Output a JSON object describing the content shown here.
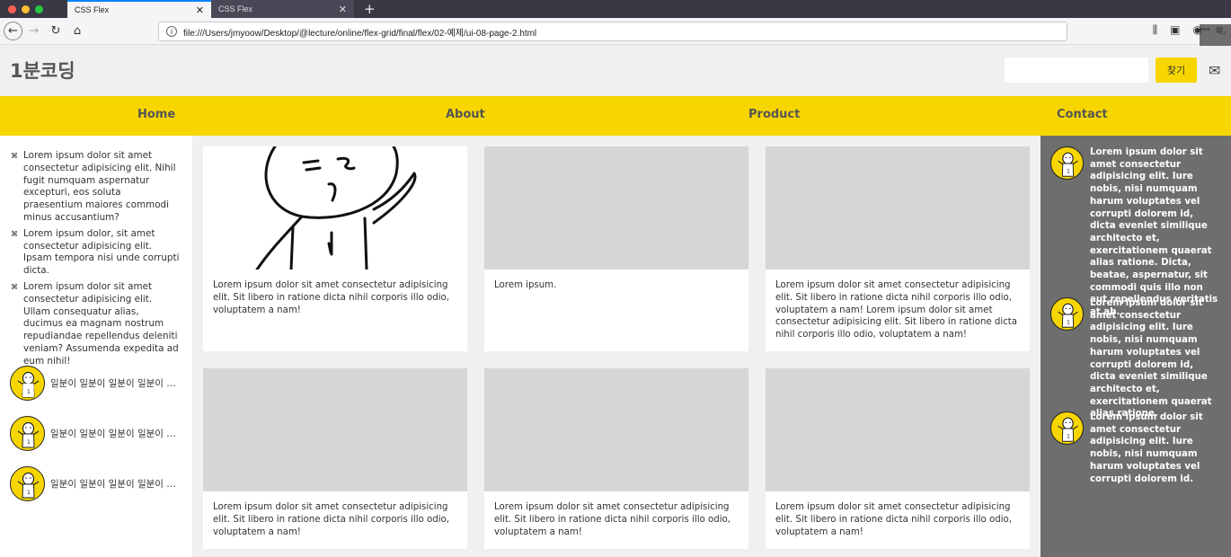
{
  "browser": {
    "tabs": [
      {
        "title": "CSS Flex",
        "active": true
      },
      {
        "title": "CSS Flex",
        "active": false
      }
    ],
    "new_tab": "+",
    "close_glyph": "✕",
    "url": "file:///Users/jmyoow/Desktop/@lecture/online/flex-grid/final/flex/02-예제/ui-08-page-2.html",
    "traffic_colors": [
      "#fe5f57",
      "#febc2e",
      "#28c840"
    ],
    "accent_color": "#0a84ff"
  },
  "header": {
    "logo": "1분코딩",
    "search_placeholder": "",
    "search_button": "찾기",
    "mail_icon": "✉"
  },
  "nav": {
    "items": [
      "Home",
      "About",
      "Product",
      "Contact"
    ],
    "background": "#f7d600"
  },
  "left": {
    "list": [
      "Lorem ipsum dolor sit amet consectetur adipisicing elit. Nihil fugit numquam aspernatur excepturi, eos soluta praesentium maiores commodi minus accusantium?",
      "Lorem ipsum dolor, sit amet consectetur adipisicing elit. Ipsam tempora nisi unde corrupti dicta.",
      "Lorem ipsum dolor sit amet consectetur adipisicing elit. Ullam consequatur alias, ducimus ea magnam nostrum repudiandae repellendus deleniti veniam? Assumenda expedita ad eum nihil!"
    ],
    "bullet": "⌘",
    "profiles": [
      {
        "label": "일분이 일분이 일분이 일분이 일분이"
      },
      {
        "label": "일분이 일분이 일분이 일분이 일분이"
      },
      {
        "label": "일분이 일분이 일분이 일분이 일분이"
      }
    ]
  },
  "cards": [
    {
      "text": "Lorem ipsum dolor sit amet consectetur adipisicing elit. Sit libero in ratione dicta nihil corporis illo odio, voluptatem a nam!",
      "image": "character-drawing"
    },
    {
      "text": "Lorem ipsum.",
      "image": "placeholder"
    },
    {
      "text": "Lorem ipsum dolor sit amet consectetur adipisicing elit. Sit libero in ratione dicta nihil corporis illo odio, voluptatem a nam! Lorem ipsum dolor sit amet consectetur adipisicing elit. Sit libero in ratione dicta nihil corporis illo odio, voluptatem a nam!",
      "image": "placeholder"
    },
    {
      "text": "Lorem ipsum dolor sit amet consectetur adipisicing elit. Sit libero in ratione dicta nihil corporis illo odio, voluptatem a nam!",
      "image": "placeholder"
    },
    {
      "text": "Lorem ipsum dolor sit amet consectetur adipisicing elit. Sit libero in ratione dicta nihil corporis illo odio, voluptatem a nam!",
      "image": "placeholder"
    },
    {
      "text": "Lorem ipsum dolor sit amet consectetur adipisicing elit. Sit libero in ratione dicta nihil corporis illo odio, voluptatem a nam!",
      "image": "placeholder"
    }
  ],
  "right": {
    "items": [
      {
        "text": "Lorem ipsum dolor sit amet consectetur adipisicing elit. Iure nobis, nisi numquam harum voluptates vel corrupti dolorem id, dicta eveniet similique architecto et, exercitationem quaerat alias ratione. Dicta, beatae, aspernatur, sit commodi quis illo non aut repellendus veritatis at ab."
      },
      {
        "text": "Lorem ipsum dolor sit amet consectetur adipisicing elit. Iure nobis, nisi numquam harum voluptates vel corrupti dolorem id, dicta eveniet similique architecto et, exercitationem quaerat alias ratione."
      },
      {
        "text": "Lorem ipsum dolor sit amet consectetur adipisicing elit. Iure nobis, nisi numquam harum voluptates vel corrupti dolorem id."
      }
    ]
  }
}
